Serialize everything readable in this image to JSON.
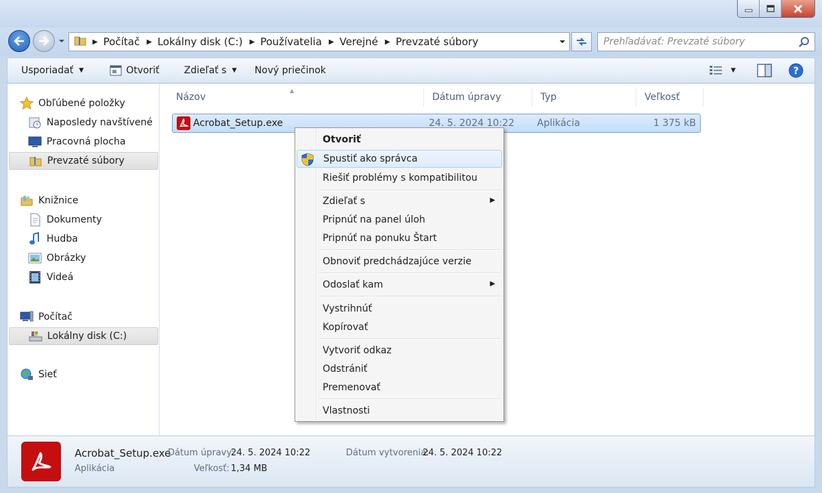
{
  "window": {
    "controls": {
      "minimize": "minimize",
      "maximize": "maximize",
      "close": "close"
    }
  },
  "address": {
    "crumbs": [
      "Počítač",
      "Lokálny disk (C:)",
      "Používatelia",
      "Verejné",
      "Prevzaté súbory"
    ]
  },
  "search": {
    "placeholder": "Prehľadávať: Prevzaté súbory"
  },
  "toolbar": {
    "organize": "Usporiadať",
    "open": "Otvoriť",
    "share": "Zdieľať s",
    "new_folder": "Nový priečinok"
  },
  "nav": {
    "favorites": "Obľúbené položky",
    "recent": "Naposledy navštívené",
    "desktop": "Pracovná plocha",
    "downloads": "Prevzaté súbory",
    "libraries": "Knižnice",
    "documents": "Dokumenty",
    "music": "Hudba",
    "pictures": "Obrázky",
    "videos": "Videá",
    "computer": "Počítač",
    "local_disk": "Lokálny disk (C:)",
    "network": "Sieť"
  },
  "columns": {
    "name": "Názov",
    "date": "Dátum úpravy",
    "type": "Typ",
    "size": "Veľkosť"
  },
  "file": {
    "name": "Acrobat_Setup.exe",
    "date": "24. 5. 2024 10:22",
    "type": "Aplikácia",
    "size": "1 375 kB"
  },
  "menu": {
    "open": "Otvoriť",
    "run_as_admin": "Spustiť ako správca",
    "compat": "Riešiť problémy s kompatibilitou",
    "share": "Zdieľať s",
    "pin_taskbar": "Pripnúť na panel úloh",
    "pin_start": "Pripnúť na ponuku Štart",
    "restore": "Obnoviť predchádzajúce verzie",
    "send_to": "Odoslať kam",
    "cut": "Vystrihnúť",
    "copy": "Kopírovať",
    "shortcut": "Vytvoriť odkaz",
    "delete": "Odstrániť",
    "rename": "Premenovať",
    "properties": "Vlastnosti"
  },
  "details": {
    "name": "Acrobat_Setup.exe",
    "type": "Aplikácia",
    "modified_label": "Dátum úpravy:",
    "modified_value": "24. 5. 2024 10:22",
    "size_label": "Veľkosť:",
    "size_value": "1,34 MB",
    "created_label": "Dátum vytvorenia:",
    "created_value": "24. 5. 2024 10:22"
  },
  "colors": {
    "accent": "#1f5fb8",
    "selection": "#c4ddfa",
    "pdf_red": "#c40e10"
  }
}
